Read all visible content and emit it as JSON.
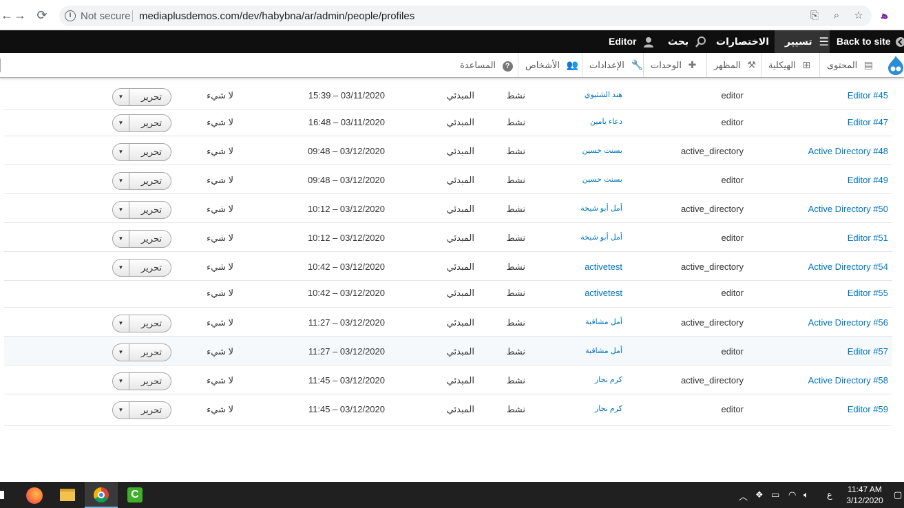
{
  "browser": {
    "security_label": "Not secure",
    "url": "mediaplusdemos.com/dev/habybna/ar/admin/people/profiles"
  },
  "toolbar": {
    "back_to_site": "Back to site",
    "manage": "تسيير",
    "shortcuts": "الاختصارات",
    "search": "بحث",
    "user": "Editor"
  },
  "tray": {
    "content": "المحتوى",
    "structure": "الهيكلية",
    "appearance": "المظهر",
    "modules": "الوحدات",
    "settings": "الإعدادات",
    "people": "الأشخاص",
    "help": "المساعدة"
  },
  "edit_label": "تحرير",
  "rows": [
    {
      "label": "Editor #45",
      "type": "editor",
      "owner": "هند الشثيوي",
      "status": "نشط",
      "lang": "المبدئي",
      "changed": "15:39 – 03/11/2020",
      "locked": "لا شيء",
      "has_edit": true
    },
    {
      "label": "Editor #47",
      "type": "editor",
      "owner": "دعاء يامين",
      "status": "نشط",
      "lang": "المبدئي",
      "changed": "16:48 – 03/11/2020",
      "locked": "لا شيء",
      "has_edit": true
    },
    {
      "label": "Active Directory #48",
      "type": "active_directory",
      "owner": "بسنت حسين",
      "status": "نشط",
      "lang": "المبدئي",
      "changed": "09:48 – 03/12/2020",
      "locked": "لا شيء",
      "has_edit": true
    },
    {
      "label": "Editor #49",
      "type": "editor",
      "owner": "بسنت حسين",
      "status": "نشط",
      "lang": "المبدئي",
      "changed": "09:48 – 03/12/2020",
      "locked": "لا شيء",
      "has_edit": true
    },
    {
      "label": "Active Directory #50",
      "type": "active_directory",
      "owner": "أمل أبو شيخة",
      "status": "نشط",
      "lang": "المبدئي",
      "changed": "10:12 – 03/12/2020",
      "locked": "لا شيء",
      "has_edit": true
    },
    {
      "label": "Editor #51",
      "type": "editor",
      "owner": "أمل أبو شيخة",
      "status": "نشط",
      "lang": "المبدئي",
      "changed": "10:12 – 03/12/2020",
      "locked": "لا شيء",
      "has_edit": true
    },
    {
      "label": "Active Directory #54",
      "type": "active_directory",
      "owner": "activetest",
      "status": "نشط",
      "lang": "المبدئي",
      "changed": "10:42 – 03/12/2020",
      "locked": "لا شيء",
      "has_edit": true
    },
    {
      "label": "Editor #55",
      "type": "editor",
      "owner": "activetest",
      "status": "نشط",
      "lang": "المبدئي",
      "changed": "10:42 – 03/12/2020",
      "locked": "لا شيء",
      "has_edit": false
    },
    {
      "label": "Active Directory #56",
      "type": "active_directory",
      "owner": "أمل مشاقبة",
      "status": "نشط",
      "lang": "المبدئي",
      "changed": "11:27 – 03/12/2020",
      "locked": "لا شيء",
      "has_edit": true
    },
    {
      "label": "Editor #57",
      "type": "editor",
      "owner": "أمل مشاقبة",
      "status": "نشط",
      "lang": "المبدئي",
      "changed": "11:27 – 03/12/2020",
      "locked": "لا شيء",
      "has_edit": true
    },
    {
      "label": "Active Directory #58",
      "type": "active_directory",
      "owner": "كرم نجار",
      "status": "نشط",
      "lang": "المبدئي",
      "changed": "11:45 – 03/12/2020",
      "locked": "لا شيء",
      "has_edit": true
    },
    {
      "label": "Editor #59",
      "type": "editor",
      "owner": "كرم نجار",
      "status": "نشط",
      "lang": "المبدئي",
      "changed": "11:45 – 03/12/2020",
      "locked": "لا شيء",
      "has_edit": true
    }
  ],
  "taskbar": {
    "input_lang": "ع",
    "time": "11:47 AM",
    "date": "3/12/2020"
  },
  "colors": {
    "link": "#0074bd",
    "toolbar_bg": "#0f0f0f",
    "taskbar_bg": "#202020"
  }
}
